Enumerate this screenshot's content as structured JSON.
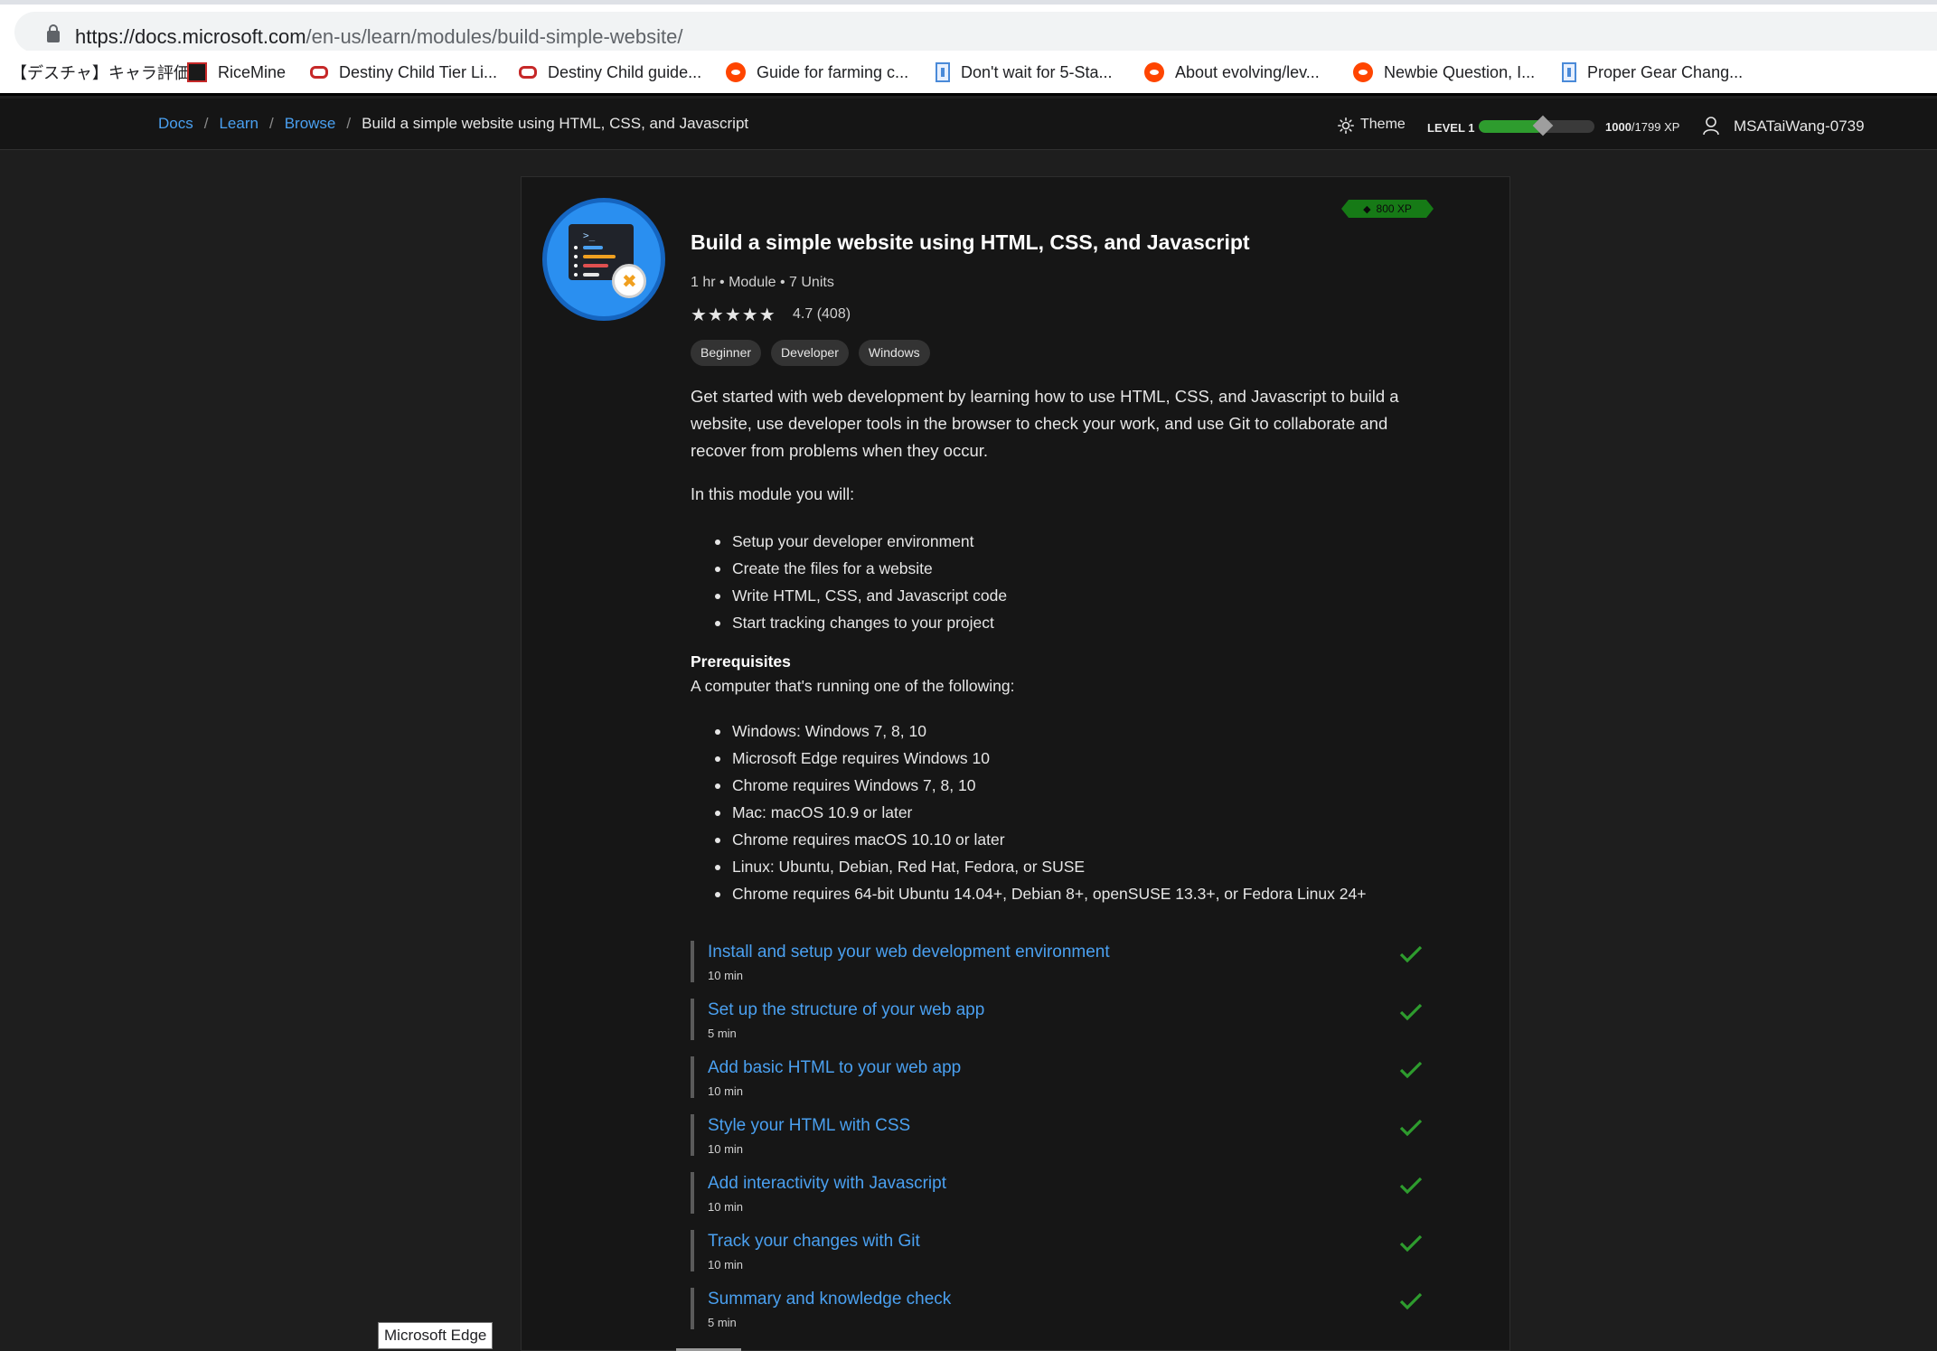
{
  "browser": {
    "url_domain": "https://docs.microsoft.com",
    "url_path": "/en-us/learn/modules/build-simple-website/",
    "bookmarks": [
      {
        "label": "【デスチャ】キャラ評価...",
        "icon": "none"
      },
      {
        "label": "RiceMine",
        "icon": "ricemine-icon"
      },
      {
        "label": "Destiny Child Tier Li...",
        "icon": "link-icon"
      },
      {
        "label": "Destiny Child guide...",
        "icon": "link-icon"
      },
      {
        "label": "Guide for farming c...",
        "icon": "reddit-icon"
      },
      {
        "label": "Don't wait for 5-Sta...",
        "icon": "doc-icon"
      },
      {
        "label": "About evolving/lev...",
        "icon": "reddit-icon"
      },
      {
        "label": "Newbie Question, I...",
        "icon": "reddit-icon"
      },
      {
        "label": "Proper Gear Chang...",
        "icon": "doc-icon"
      }
    ],
    "tooltip": "Microsoft Edge"
  },
  "header": {
    "breadcrumbs": [
      "Docs",
      "Learn",
      "Browse"
    ],
    "current": "Build a simple website using HTML, CSS, and Javascript",
    "theme_label": "Theme",
    "level_label": "LEVEL 1",
    "xp_current": "1000",
    "xp_total": "/1799 XP",
    "xp_fraction": 0.556,
    "username": "MSATaiWang-0739"
  },
  "module": {
    "xp_badge": "800 XP",
    "title": "Build a simple website using HTML, CSS, and Javascript",
    "meta": "1 hr • Module • 7 Units",
    "stars": "★★★★★",
    "rating": "4.7 (408)",
    "tags": [
      "Beginner",
      "Developer",
      "Windows"
    ],
    "description": "Get started with web development by learning how to use HTML, CSS, and Javascript to build a website, use developer tools in the browser to check your work, and use Git to collaborate and recover from problems when they occur.",
    "intro": "In this module you will:",
    "goals": [
      "Setup your developer environment",
      "Create the files for a website",
      "Write HTML, CSS, and Javascript code",
      "Start tracking changes to your project"
    ],
    "prereq_heading": "Prerequisites",
    "prereq_text": "A computer that's running one of the following:",
    "prereqs": [
      "Windows: Windows 7, 8, 10",
      "Microsoft Edge requires Windows 10",
      "Chrome requires Windows 7, 8, 10",
      "Mac: macOS 10.9 or later",
      "Chrome requires macOS 10.10 or later",
      "Linux: Ubuntu, Debian, Red Hat, Fedora, or SUSE",
      "Chrome requires 64-bit Ubuntu 14.04+, Debian 8+, openSUSE 13.3+, or Fedora Linux 24+"
    ],
    "units": [
      {
        "name": "Install and setup your web development environment",
        "duration": "10 min",
        "completed": true
      },
      {
        "name": "Set up the structure of your web app",
        "duration": "5 min",
        "completed": true
      },
      {
        "name": "Add basic HTML to your web app",
        "duration": "10 min",
        "completed": true
      },
      {
        "name": "Style your HTML with CSS",
        "duration": "10 min",
        "completed": true
      },
      {
        "name": "Add interactivity with Javascript",
        "duration": "10 min",
        "completed": true
      },
      {
        "name": "Track your changes with Git",
        "duration": "10 min",
        "completed": true
      },
      {
        "name": "Summary and knowledge check",
        "duration": "5 min",
        "completed": true
      }
    ]
  },
  "colors": {
    "accent_link": "#4aa0f0",
    "xp_green": "#2e9c2e",
    "check_green": "#2e9c2e",
    "page_bg": "#1e1e1e"
  }
}
